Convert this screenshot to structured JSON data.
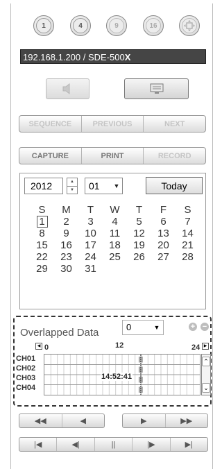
{
  "channel_buttons": [
    {
      "label": "1",
      "icon": "single-view-icon"
    },
    {
      "label": "4",
      "icon": "quad-view-icon"
    },
    {
      "label": "9",
      "icon": "nine-view-icon"
    },
    {
      "label": "16",
      "icon": "sixteen-view-icon"
    },
    {
      "label": "",
      "icon": "fullscreen-icon"
    }
  ],
  "address": {
    "text": "192.168.1.200  / SDE-500",
    "model_suffix": "X"
  },
  "controls": {
    "audio_icon": "speaker-icon",
    "display_icon": "monitor-icon"
  },
  "playback_group": {
    "sequence": "SEQUENCE",
    "previous": "PREVIOUS",
    "next": "NEXT"
  },
  "action_group": {
    "capture": "CAPTURE",
    "print": "PRINT",
    "record": "RECORD"
  },
  "calendar": {
    "year": "2012",
    "month": "01",
    "today_label": "Today",
    "weekdays": [
      "S",
      "M",
      "T",
      "W",
      "T",
      "F",
      "S"
    ],
    "weeks": [
      [
        "1",
        "2",
        "3",
        "4",
        "5",
        "6",
        "7"
      ],
      [
        "8",
        "9",
        "10",
        "11",
        "12",
        "13",
        "14"
      ],
      [
        "15",
        "16",
        "17",
        "18",
        "19",
        "20",
        "21"
      ],
      [
        "22",
        "23",
        "24",
        "25",
        "26",
        "27",
        "28"
      ],
      [
        "29",
        "30",
        "31",
        "",
        "",
        "",
        ""
      ]
    ],
    "selected_day": "1"
  },
  "overlapped": {
    "label": "Overlapped Data",
    "value": "0",
    "timeline": {
      "start": "0",
      "mid": "12",
      "end": "24"
    },
    "channels": [
      "CH01",
      "CH02",
      "CH03",
      "CH04"
    ],
    "time_readout": "14:52:41",
    "cursor_hour": 14.88
  },
  "nav_row1": [
    "◀◀",
    "◀",
    "▶",
    "▶▶"
  ],
  "nav_row2": [
    "|◀",
    "◀|",
    "||",
    "|▶",
    "▶|"
  ],
  "colors": {
    "accent": "#454545",
    "border": "#999999"
  }
}
